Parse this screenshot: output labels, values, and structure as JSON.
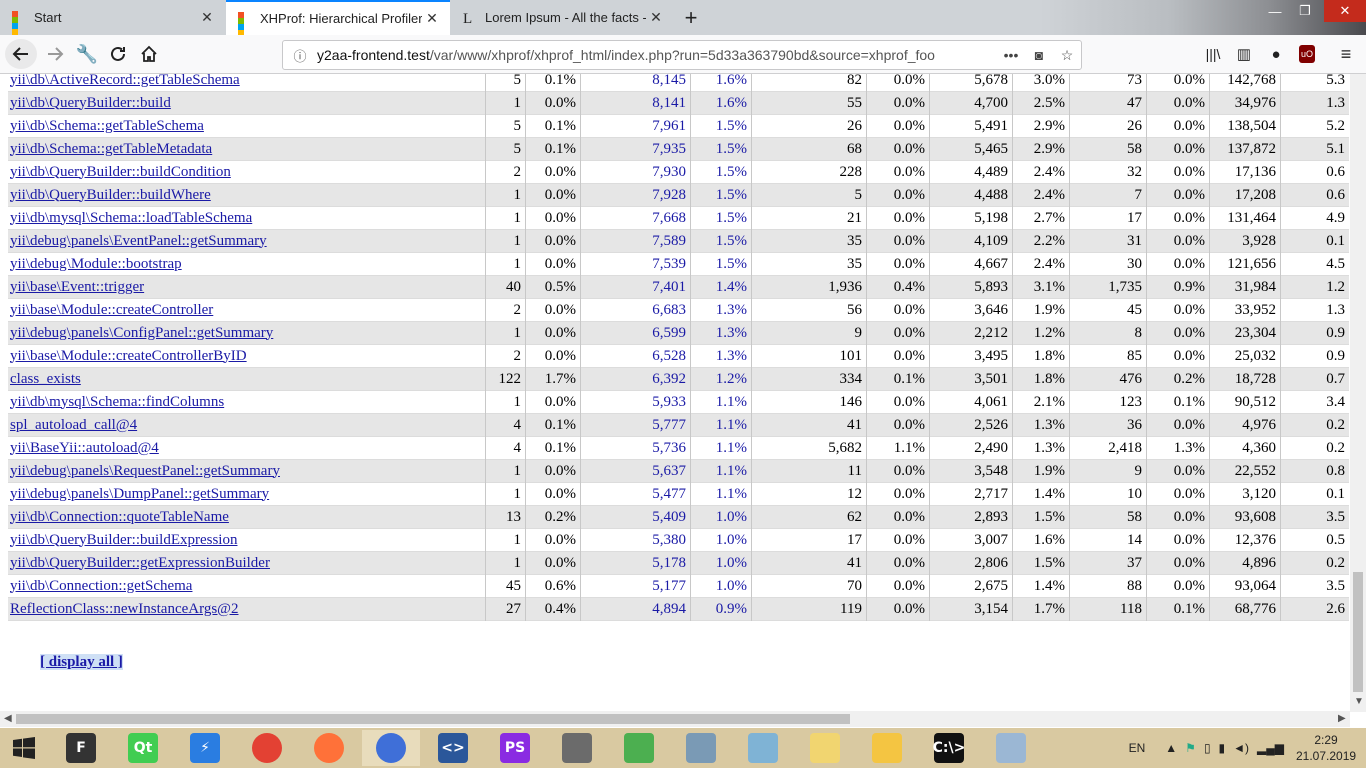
{
  "tabs": [
    {
      "label": "Start",
      "active": false
    },
    {
      "label": "XHProf: Hierarchical Profiler Re",
      "active": true
    },
    {
      "label": "Lorem Ipsum - All the facts - Li",
      "active": false
    }
  ],
  "new_tab_label": "+",
  "url": {
    "host": "y2aa-frontend.test",
    "path": "/var/www/xhprof/xhprof_html/index.php?run=5d33a363790bd&source=xhprof_foo"
  },
  "rows": [
    [
      "yii\\db\\ActiveRecord::getTableSchema",
      "5",
      "0.1%",
      "8,145",
      "1.6%",
      "82",
      "0.0%",
      "5,678",
      "3.0%",
      "73",
      "0.0%",
      "142,768",
      "5.3"
    ],
    [
      "yii\\db\\QueryBuilder::build",
      "1",
      "0.0%",
      "8,141",
      "1.6%",
      "55",
      "0.0%",
      "4,700",
      "2.5%",
      "47",
      "0.0%",
      "34,976",
      "1.3"
    ],
    [
      "yii\\db\\Schema::getTableSchema",
      "5",
      "0.1%",
      "7,961",
      "1.5%",
      "26",
      "0.0%",
      "5,491",
      "2.9%",
      "26",
      "0.0%",
      "138,504",
      "5.2"
    ],
    [
      "yii\\db\\Schema::getTableMetadata",
      "5",
      "0.1%",
      "7,935",
      "1.5%",
      "68",
      "0.0%",
      "5,465",
      "2.9%",
      "58",
      "0.0%",
      "137,872",
      "5.1"
    ],
    [
      "yii\\db\\QueryBuilder::buildCondition",
      "2",
      "0.0%",
      "7,930",
      "1.5%",
      "228",
      "0.0%",
      "4,489",
      "2.4%",
      "32",
      "0.0%",
      "17,136",
      "0.6"
    ],
    [
      "yii\\db\\QueryBuilder::buildWhere",
      "1",
      "0.0%",
      "7,928",
      "1.5%",
      "5",
      "0.0%",
      "4,488",
      "2.4%",
      "7",
      "0.0%",
      "17,208",
      "0.6"
    ],
    [
      "yii\\db\\mysql\\Schema::loadTableSchema",
      "1",
      "0.0%",
      "7,668",
      "1.5%",
      "21",
      "0.0%",
      "5,198",
      "2.7%",
      "17",
      "0.0%",
      "131,464",
      "4.9"
    ],
    [
      "yii\\debug\\panels\\EventPanel::getSummary",
      "1",
      "0.0%",
      "7,589",
      "1.5%",
      "35",
      "0.0%",
      "4,109",
      "2.2%",
      "31",
      "0.0%",
      "3,928",
      "0.1"
    ],
    [
      "yii\\debug\\Module::bootstrap",
      "1",
      "0.0%",
      "7,539",
      "1.5%",
      "35",
      "0.0%",
      "4,667",
      "2.4%",
      "30",
      "0.0%",
      "121,656",
      "4.5"
    ],
    [
      "yii\\base\\Event::trigger",
      "40",
      "0.5%",
      "7,401",
      "1.4%",
      "1,936",
      "0.4%",
      "5,893",
      "3.1%",
      "1,735",
      "0.9%",
      "31,984",
      "1.2"
    ],
    [
      "yii\\base\\Module::createController",
      "2",
      "0.0%",
      "6,683",
      "1.3%",
      "56",
      "0.0%",
      "3,646",
      "1.9%",
      "45",
      "0.0%",
      "33,952",
      "1.3"
    ],
    [
      "yii\\debug\\panels\\ConfigPanel::getSummary",
      "1",
      "0.0%",
      "6,599",
      "1.3%",
      "9",
      "0.0%",
      "2,212",
      "1.2%",
      "8",
      "0.0%",
      "23,304",
      "0.9"
    ],
    [
      "yii\\base\\Module::createControllerByID",
      "2",
      "0.0%",
      "6,528",
      "1.3%",
      "101",
      "0.0%",
      "3,495",
      "1.8%",
      "85",
      "0.0%",
      "25,032",
      "0.9"
    ],
    [
      "class_exists",
      "122",
      "1.7%",
      "6,392",
      "1.2%",
      "334",
      "0.1%",
      "3,501",
      "1.8%",
      "476",
      "0.2%",
      "18,728",
      "0.7"
    ],
    [
      "yii\\db\\mysql\\Schema::findColumns",
      "1",
      "0.0%",
      "5,933",
      "1.1%",
      "146",
      "0.0%",
      "4,061",
      "2.1%",
      "123",
      "0.1%",
      "90,512",
      "3.4"
    ],
    [
      "spl_autoload_call@4",
      "4",
      "0.1%",
      "5,777",
      "1.1%",
      "41",
      "0.0%",
      "2,526",
      "1.3%",
      "36",
      "0.0%",
      "4,976",
      "0.2"
    ],
    [
      "yii\\BaseYii::autoload@4",
      "4",
      "0.1%",
      "5,736",
      "1.1%",
      "5,682",
      "1.1%",
      "2,490",
      "1.3%",
      "2,418",
      "1.3%",
      "4,360",
      "0.2"
    ],
    [
      "yii\\debug\\panels\\RequestPanel::getSummary",
      "1",
      "0.0%",
      "5,637",
      "1.1%",
      "11",
      "0.0%",
      "3,548",
      "1.9%",
      "9",
      "0.0%",
      "22,552",
      "0.8"
    ],
    [
      "yii\\debug\\panels\\DumpPanel::getSummary",
      "1",
      "0.0%",
      "5,477",
      "1.1%",
      "12",
      "0.0%",
      "2,717",
      "1.4%",
      "10",
      "0.0%",
      "3,120",
      "0.1"
    ],
    [
      "yii\\db\\Connection::quoteTableName",
      "13",
      "0.2%",
      "5,409",
      "1.0%",
      "62",
      "0.0%",
      "2,893",
      "1.5%",
      "58",
      "0.0%",
      "93,608",
      "3.5"
    ],
    [
      "yii\\db\\QueryBuilder::buildExpression",
      "1",
      "0.0%",
      "5,380",
      "1.0%",
      "17",
      "0.0%",
      "3,007",
      "1.6%",
      "14",
      "0.0%",
      "12,376",
      "0.5"
    ],
    [
      "yii\\db\\QueryBuilder::getExpressionBuilder",
      "1",
      "0.0%",
      "5,178",
      "1.0%",
      "41",
      "0.0%",
      "2,806",
      "1.5%",
      "37",
      "0.0%",
      "4,896",
      "0.2"
    ],
    [
      "yii\\db\\Connection::getSchema",
      "45",
      "0.6%",
      "5,177",
      "1.0%",
      "70",
      "0.0%",
      "2,675",
      "1.4%",
      "88",
      "0.0%",
      "93,064",
      "3.5"
    ],
    [
      "ReflectionClass::newInstanceArgs@2",
      "27",
      "0.4%",
      "4,894",
      "0.9%",
      "119",
      "0.0%",
      "3,154",
      "1.7%",
      "118",
      "0.1%",
      "68,776",
      "2.6"
    ]
  ],
  "display_all": "[ display all ]",
  "taskbar": {
    "apps": [
      {
        "name": "start",
        "icon": "windows-logo-icon"
      },
      {
        "name": "app-f",
        "glyph": "F",
        "color": "#333333"
      },
      {
        "name": "qt",
        "glyph": "Qt",
        "color": "#41cd52"
      },
      {
        "name": "bolt",
        "glyph": "⚡",
        "color": "#2a7de1"
      },
      {
        "name": "chrome",
        "glyph": "",
        "color": "#e34133"
      },
      {
        "name": "firefox",
        "glyph": "",
        "color": "#ff7139"
      },
      {
        "name": "firefox-dev",
        "glyph": "",
        "color": "#3f6fd8"
      },
      {
        "name": "code",
        "glyph": "<>",
        "color": "#2b579a"
      },
      {
        "name": "phpstorm",
        "glyph": "PS",
        "color": "#8a2be2"
      },
      {
        "name": "mask",
        "glyph": "",
        "color": "#6b6b6b"
      },
      {
        "name": "editor",
        "glyph": "",
        "color": "#4caf50"
      },
      {
        "name": "monitor",
        "glyph": "",
        "color": "#7a9ab5"
      },
      {
        "name": "notepad",
        "glyph": "",
        "color": "#7fb3d5"
      },
      {
        "name": "sticky",
        "glyph": "",
        "color": "#f1d570"
      },
      {
        "name": "explorer",
        "glyph": "",
        "color": "#f4c542"
      },
      {
        "name": "terminal",
        "glyph": "C:\\>",
        "color": "#111111"
      },
      {
        "name": "paint",
        "glyph": "",
        "color": "#9bb7d4"
      }
    ],
    "lang": "EN",
    "time": "2:29",
    "date": "21.07.2019"
  }
}
